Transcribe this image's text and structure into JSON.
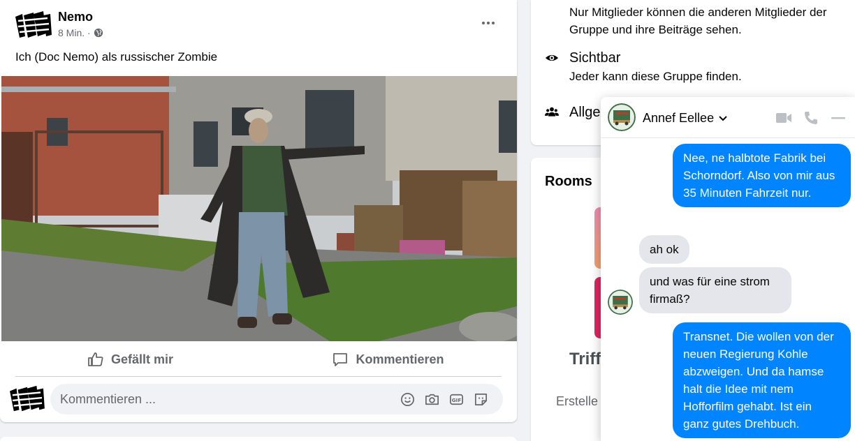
{
  "post": {
    "author": "Nemo",
    "time": "8 Min. ·",
    "text": "Ich (Doc Nemo) als russischer Zombie",
    "actions": {
      "like": "Gefällt mir",
      "comment": "Kommentieren"
    },
    "comment_placeholder": "Kommentieren ..."
  },
  "about": {
    "members_desc": "Nur Mitglieder können die anderen Mitglieder der Gruppe und ihre Beiträge sehen.",
    "visibility_title": "Sichtbar",
    "visibility_desc": "Jeder kann diese Gruppe finden.",
    "general_title": "Allge"
  },
  "rooms": {
    "title": "Rooms",
    "partial_title": "Triff",
    "partial_sub": "Erstelle"
  },
  "chat": {
    "contact_name": "Annef Eellee",
    "messages": [
      {
        "direction": "out",
        "text": "Nee, ne halbtote Fabrik bei Schorndorf. Also von mir aus 35 Minuten Fahrzeit nur."
      },
      {
        "direction": "in",
        "text": "ah ok"
      },
      {
        "direction": "in",
        "text": "und was für eine strom firmaß?"
      },
      {
        "direction": "out",
        "text": "Transnet. Die wollen von der neuen Regierung Kohle abzweigen. Und da hamse halt die Idee mit nem Hofforfilm gehabt. Ist ein ganz gutes Drehbuch."
      }
    ]
  },
  "colors": {
    "accent_blue": "#0084ff",
    "page_background": "#f0f2f5",
    "secondary_text": "#65676b"
  },
  "icons": [
    "more-icon",
    "globe-icon",
    "like-icon",
    "comment-icon",
    "emoji-icon",
    "camera-icon",
    "gif-icon",
    "sticker-icon",
    "eye-icon",
    "group-icon",
    "video-call-icon",
    "phone-icon",
    "minimize-icon",
    "chevron-down-icon"
  ]
}
